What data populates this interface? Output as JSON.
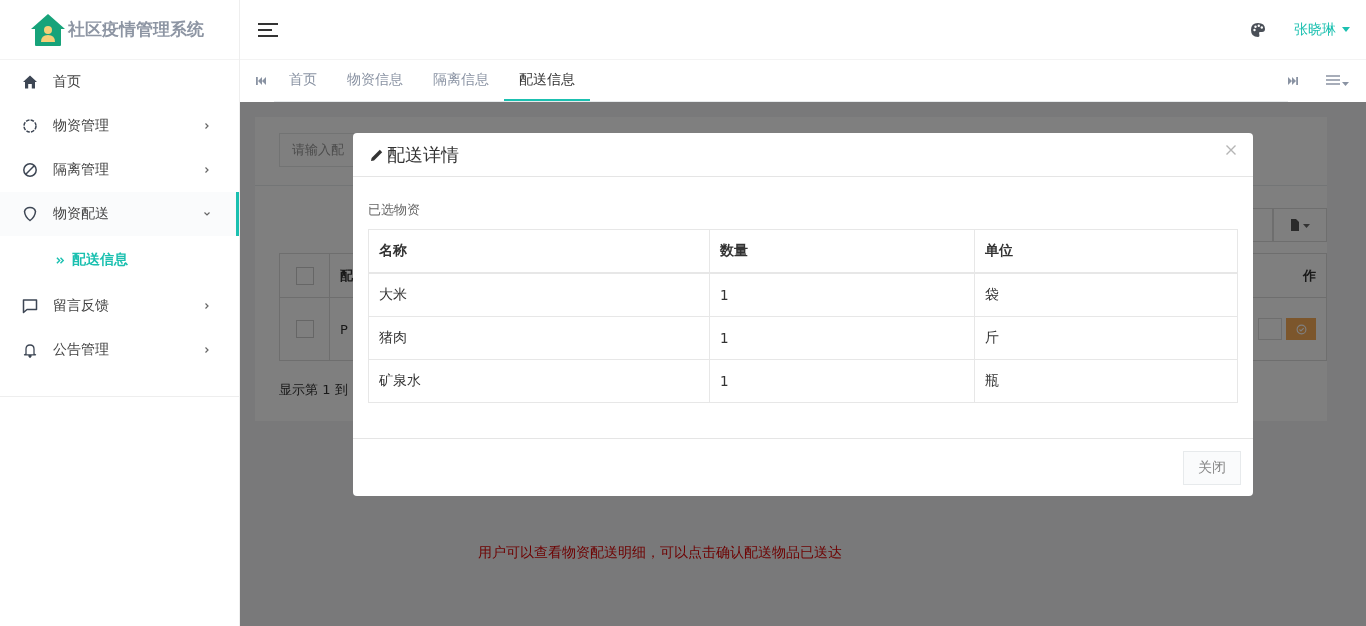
{
  "app": {
    "title": "社区疫情管理系统"
  },
  "sidebar": {
    "items": [
      {
        "label": "首页",
        "kind": "link",
        "expanded": false
      },
      {
        "label": "物资管理",
        "kind": "group",
        "expanded": false
      },
      {
        "label": "隔离管理",
        "kind": "group",
        "expanded": false
      },
      {
        "label": "物资配送",
        "kind": "group",
        "expanded": true,
        "children": [
          {
            "label": "配送信息",
            "selected": true
          }
        ]
      },
      {
        "label": "留言反馈",
        "kind": "group",
        "expanded": false
      },
      {
        "label": "公告管理",
        "kind": "group",
        "expanded": false
      }
    ]
  },
  "header": {
    "user": "张晓琳"
  },
  "tabs": [
    {
      "label": "首页",
      "selected": false
    },
    {
      "label": "物资信息",
      "selected": false
    },
    {
      "label": "隔离信息",
      "selected": false
    },
    {
      "label": "配送信息",
      "selected": true
    }
  ],
  "page": {
    "search": {
      "placeholder": "请输入配"
    },
    "table": {
      "columns": [
        "配",
        "作"
      ],
      "rows": [
        {
          "column_2": "P",
          "checked": false
        }
      ]
    },
    "header_checked": false,
    "pager": "显示第 1 到"
  },
  "modal": {
    "title": "配送详情",
    "section_label": "已选物资",
    "columns": [
      "名称",
      "数量",
      "单位"
    ],
    "rows": [
      [
        "大米",
        "1",
        "袋"
      ],
      [
        "猪肉",
        "1",
        "斤"
      ],
      [
        "矿泉水",
        "1",
        "瓶"
      ]
    ],
    "close_button": "关闭"
  },
  "annotation": "用户可以查看物资配送明细，可以点击确认配送物品已送达"
}
